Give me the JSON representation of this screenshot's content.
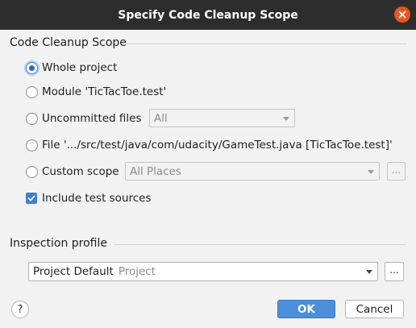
{
  "window": {
    "title": "Specify Code Cleanup Scope"
  },
  "scope": {
    "section_title": "Code Cleanup Scope",
    "options": [
      {
        "label": "Whole project",
        "checked": true
      },
      {
        "label": "Module 'TicTacToe.test'",
        "checked": false
      },
      {
        "label": "Uncommitted files",
        "checked": false,
        "combo_value": "All"
      },
      {
        "label": "File '.../src/test/java/com/udacity/GameTest.java [TicTacToe.test]'",
        "checked": false
      },
      {
        "label": "Custom scope",
        "checked": false,
        "combo_value": "All Places",
        "browse_label": "..."
      }
    ],
    "include_tests": {
      "label": "Include test sources",
      "checked": true
    }
  },
  "profile": {
    "section_title": "Inspection profile",
    "name": "Project Default",
    "scope_hint": "Project",
    "browse_label": "..."
  },
  "footer": {
    "help_label": "?",
    "ok_label": "OK",
    "cancel_label": "Cancel"
  },
  "colors": {
    "accent": "#4b8fdb",
    "close": "#e95420",
    "titlebar": "#2d2d2d"
  }
}
